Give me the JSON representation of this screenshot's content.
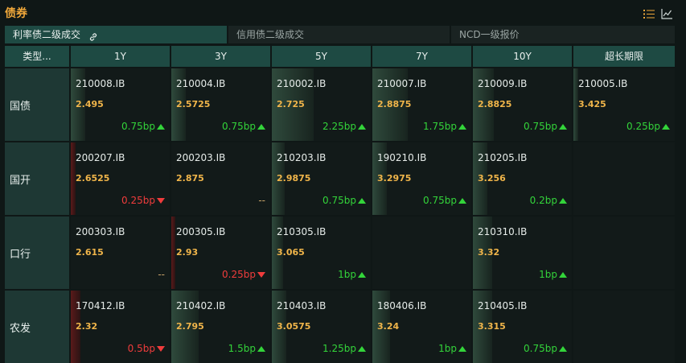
{
  "panel": {
    "title": "债券"
  },
  "tabs": [
    {
      "label": "利率债二级成交",
      "active": true
    },
    {
      "label": "信用债二级成交",
      "active": false
    },
    {
      "label": "NCD一级报价",
      "active": false
    }
  ],
  "columns": [
    "类型...",
    "1Y",
    "3Y",
    "5Y",
    "7Y",
    "10Y",
    "超长期限"
  ],
  "rows": [
    {
      "label": "国债",
      "cells": [
        {
          "code": "210008.IB",
          "price": "2.495",
          "change": "0.75bp",
          "dir": "up"
        },
        {
          "code": "210004.IB",
          "price": "2.5725",
          "change": "0.75bp",
          "dir": "up"
        },
        {
          "code": "210002.IB",
          "price": "2.725",
          "change": "2.25bp",
          "dir": "up"
        },
        {
          "code": "210007.IB",
          "price": "2.8875",
          "change": "1.75bp",
          "dir": "up"
        },
        {
          "code": "210009.IB",
          "price": "2.8825",
          "change": "0.75bp",
          "dir": "up"
        },
        {
          "code": "210005.IB",
          "price": "3.425",
          "change": "0.25bp",
          "dir": "up"
        }
      ]
    },
    {
      "label": "国开",
      "cells": [
        {
          "code": "200207.IB",
          "price": "2.6525",
          "change": "0.25bp",
          "dir": "down"
        },
        {
          "code": "200203.IB",
          "price": "2.875",
          "change": "--",
          "dir": "flat"
        },
        {
          "code": "210203.IB",
          "price": "2.9875",
          "change": "0.75bp",
          "dir": "up"
        },
        {
          "code": "190210.IB",
          "price": "3.2975",
          "change": "0.75bp",
          "dir": "up"
        },
        {
          "code": "210205.IB",
          "price": "3.256",
          "change": "0.2bp",
          "dir": "up"
        },
        {
          "code": "",
          "price": "",
          "change": "",
          "dir": "none"
        }
      ]
    },
    {
      "label": "口行",
      "cells": [
        {
          "code": "200303.IB",
          "price": "2.615",
          "change": "--",
          "dir": "flat"
        },
        {
          "code": "200305.IB",
          "price": "2.93",
          "change": "0.25bp",
          "dir": "down"
        },
        {
          "code": "210305.IB",
          "price": "3.065",
          "change": "1bp",
          "dir": "up"
        },
        {
          "code": "",
          "price": "",
          "change": "",
          "dir": "none"
        },
        {
          "code": "210310.IB",
          "price": "3.32",
          "change": "1bp",
          "dir": "up"
        },
        {
          "code": "",
          "price": "",
          "change": "",
          "dir": "none"
        }
      ]
    },
    {
      "label": "农发",
      "cells": [
        {
          "code": "170412.IB",
          "price": "2.32",
          "change": "0.5bp",
          "dir": "down"
        },
        {
          "code": "210402.IB",
          "price": "2.795",
          "change": "1.5bp",
          "dir": "up"
        },
        {
          "code": "210403.IB",
          "price": "3.0575",
          "change": "1.25bp",
          "dir": "up"
        },
        {
          "code": "180406.IB",
          "price": "3.24",
          "change": "1bp",
          "dir": "up"
        },
        {
          "code": "210405.IB",
          "price": "3.315",
          "change": "0.75bp",
          "dir": "up"
        },
        {
          "code": "",
          "price": "",
          "change": "",
          "dir": "none"
        }
      ]
    }
  ],
  "colors": {
    "accent": "#f0a83a",
    "up": "#33d43a",
    "down": "#f03c3c",
    "header_bg": "#1e4a43",
    "price": "#f0b54a"
  },
  "icons": {
    "list": "list-icon",
    "chart": "line-chart-icon",
    "link": "link-icon"
  }
}
